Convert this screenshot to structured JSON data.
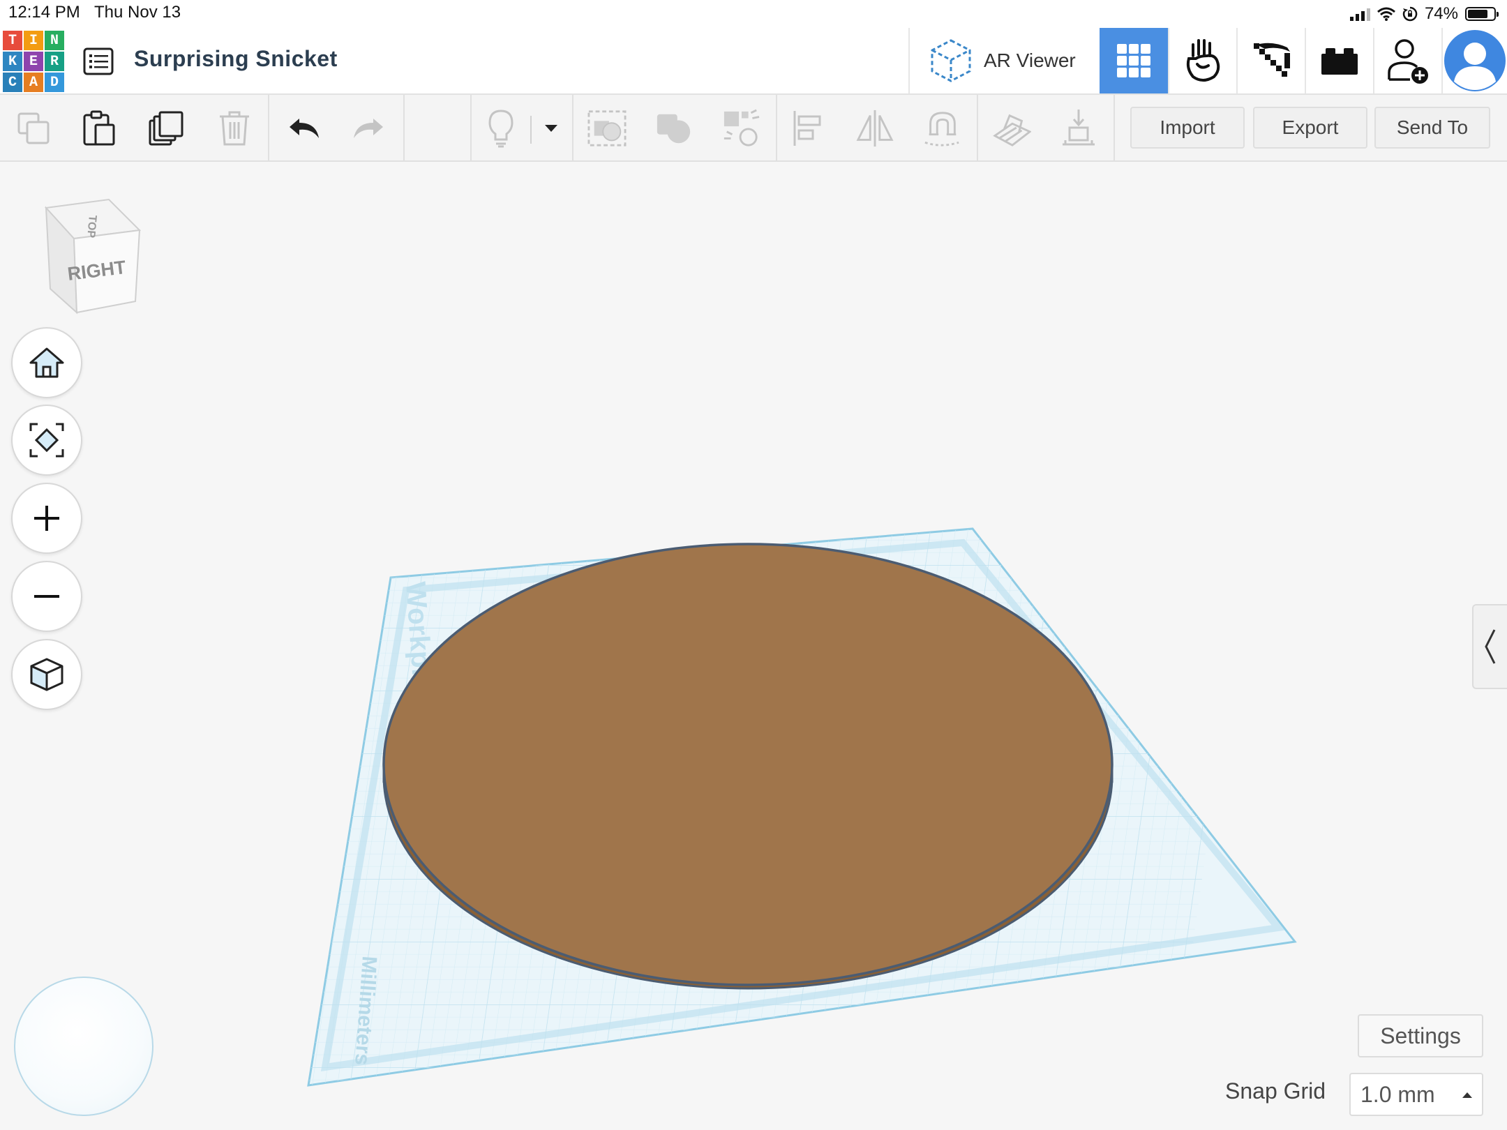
{
  "status_bar": {
    "time": "12:14 PM",
    "date": "Thu Nov 13",
    "battery": "74%"
  },
  "app": {
    "logo_letters": [
      "T",
      "I",
      "N",
      "K",
      "E",
      "R",
      "C",
      "A",
      "D"
    ],
    "logo_colors": [
      "#e74c3c",
      "#f39c12",
      "#27ae60",
      "#2e86c1",
      "#8e44ad",
      "#16a085",
      "#2980b9",
      "#e67e22",
      "#3498db"
    ],
    "project_title": "Surprising Snicket"
  },
  "header": {
    "ar_viewer_label": "AR Viewer",
    "icons": [
      "ar-viewer-icon",
      "grid-view-icon",
      "blocks-icon",
      "pickaxe-icon",
      "bricks-icon",
      "invite-user-icon",
      "avatar"
    ],
    "active_color": "#4a8fe2"
  },
  "toolbar": {
    "import_label": "Import",
    "export_label": "Export",
    "send_to_label": "Send To",
    "icons": [
      "copy-icon",
      "paste-icon",
      "duplicate-icon",
      "delete-icon",
      "undo-icon",
      "redo-icon",
      "lightbulb-icon",
      "dropdown-caret-icon",
      "group-icon",
      "ungroup-icon",
      "hole-solid-icon",
      "align-icon",
      "mirror-icon",
      "cruise-icon",
      "workplane-icon",
      "drop-icon"
    ]
  },
  "viewcube": {
    "top_label": "TOP",
    "right_label": "RIGHT"
  },
  "nav_controls": [
    "home-view-icon",
    "fit-view-icon",
    "zoom-in-icon",
    "zoom-out-icon",
    "perspective-cube-icon"
  ],
  "workplane": {
    "label": "Workplane",
    "units_label": "Millimeters",
    "grid_color": "#bfe1ef",
    "edge_color": "#8ecbe4"
  },
  "shape": {
    "type": "cylinder",
    "fill_color": "#a0754b",
    "side_color": "#8a6035",
    "edge_color": "#4b5c72"
  },
  "settings": {
    "label": "Settings",
    "snap_grid_label": "Snap Grid",
    "snap_grid_value": "1.0 mm"
  }
}
